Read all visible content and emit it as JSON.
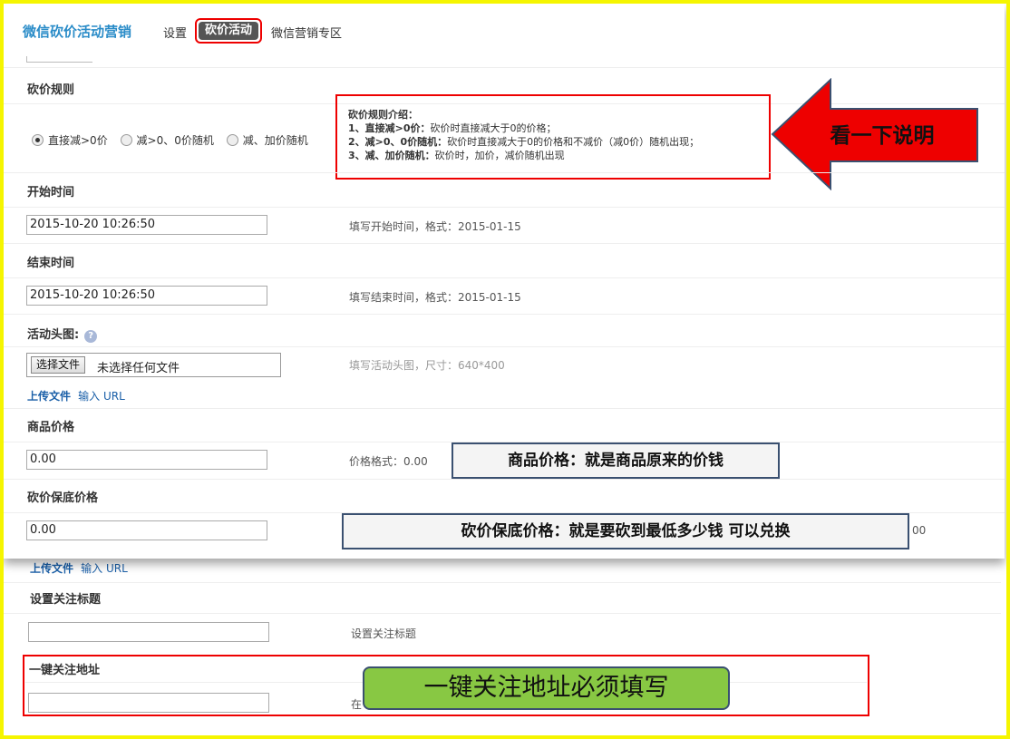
{
  "header": {
    "title": "微信砍价活动营销",
    "nav": {
      "settings": "设置",
      "active": "砍价活动",
      "zone": "微信营销专区"
    }
  },
  "rules": {
    "label": "砍价规则",
    "options": [
      "直接减>0价",
      "减>0、0价随机",
      "减、加价随机"
    ],
    "selected_index": 0,
    "intro_title": "砍价规则介绍：",
    "items": [
      {
        "num": "1、",
        "bold": "直接减>0价：",
        "text": "砍价时直接减大于0的价格；"
      },
      {
        "num": "2、",
        "bold": "减>0、0价随机：",
        "text": "砍价时直接减大于0的价格和不减价（减0价）随机出现；"
      },
      {
        "num": "3、",
        "bold": "减、加价随机：",
        "text": "砍价时，加价，减价随机出现"
      }
    ]
  },
  "start": {
    "label": "开始时间",
    "value": "2015-10-20 10:26:50",
    "hint": "填写开始时间，格式：2015-01-15"
  },
  "end": {
    "label": "结束时间",
    "value": "2015-10-20 10:26:50",
    "hint": "填写结束时间，格式：2015-01-15"
  },
  "image": {
    "label": "活动头图:",
    "help": "?",
    "button": "选择文件",
    "no_file": "未选择任何文件",
    "hint": "填写活动头图，尺寸：640*400",
    "upload": "上传文件",
    "input_url": "输入 URL"
  },
  "price": {
    "label": "商品价格",
    "value": "0.00",
    "hint": "价格格式：0.00"
  },
  "floor": {
    "label": "砍价保底价格",
    "value": "0.00",
    "hint_tail": "00"
  },
  "upload2": {
    "upload": "上传文件",
    "input_url": "输入 URL"
  },
  "follow_title": {
    "label": "设置关注标题",
    "value": "",
    "hint": "设置关注标题"
  },
  "follow_url": {
    "label": "一键关注地址",
    "value": "",
    "hint": "在"
  },
  "callouts": {
    "arrow": "看一下说明",
    "price": "商品价格：就是商品原来的价钱",
    "floor": "砍价保底价格：就是要砍到最低多少钱 可以兑换",
    "follow": "一键关注地址必须填写"
  },
  "colors": {
    "frame": "#f5f500",
    "highlight": "#ee0000",
    "title": "#2a8cc8",
    "arrow": "#ee0000",
    "green_callout": "#88c843"
  }
}
